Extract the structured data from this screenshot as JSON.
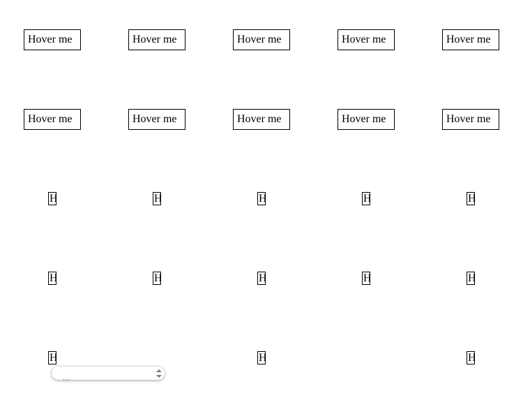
{
  "grid": {
    "row1": [
      "Hover me",
      "Hover me",
      "Hover me",
      "Hover me",
      "Hover me"
    ],
    "row2": [
      "Hover me",
      "Hover me",
      "Hover me",
      "Hover me",
      "Hover me"
    ],
    "row3": [
      "H",
      "H",
      "H",
      "H",
      "H"
    ],
    "row4": [
      "H",
      "H",
      "H",
      "H",
      "H"
    ],
    "row5": [
      "H",
      "",
      "H",
      "",
      "H"
    ]
  },
  "tooltip": {
    "text": "...",
    "icon": "spinner-icon"
  }
}
